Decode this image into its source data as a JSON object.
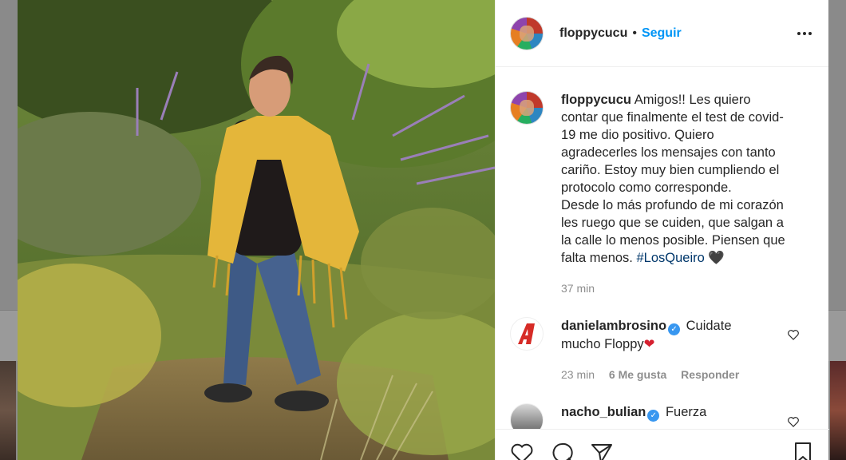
{
  "post": {
    "author": "floppycucu",
    "separator": "•",
    "follow_label": "Seguir",
    "caption_lines": [
      "Amigos!! Les quiero",
      "contar que finalmente el test de covid-",
      "19 me dio positivo. Quiero",
      "agradecerles los mensajes con tanto",
      "cariño. Estoy muy bien cumpliendo el",
      "protocolo como corresponde.",
      "Desde lo más profundo de mi corazón",
      "les ruego que se cuiden, que salgan a",
      "la calle lo menos posible. Piensen que",
      "falta menos."
    ],
    "hashtag": "#LosQueiro",
    "emoji": "🖤",
    "time": "37 min"
  },
  "comments": [
    {
      "user": "danielambrosino",
      "verified": true,
      "text_line1": "Cuidate",
      "text_line2": "mucho Floppy",
      "emoji": "❤",
      "time": "23 min",
      "likes": "6 Me gusta",
      "reply": "Responder"
    },
    {
      "user": "nacho_bulian",
      "verified": true,
      "text_line1": "Fuerza"
    }
  ],
  "icons": {
    "more": "more-options-icon",
    "like": "heart-icon",
    "comment": "comment-icon",
    "share": "paper-plane-icon",
    "save": "bookmark-icon",
    "verified_mark": "✓"
  },
  "colors": {
    "follow": "#0095f6",
    "hashtag": "#00376b",
    "muted": "#8e8e8e",
    "verified": "#3897f0"
  }
}
